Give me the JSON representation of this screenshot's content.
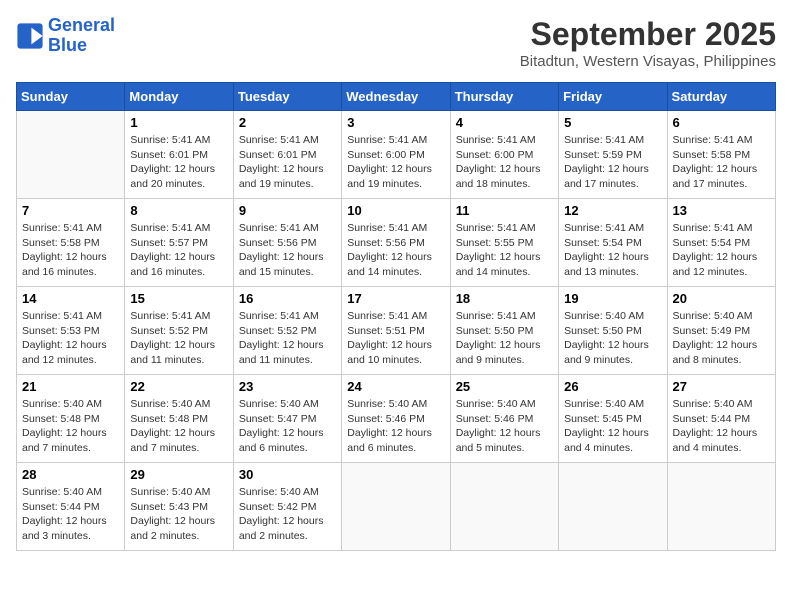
{
  "header": {
    "logo_line1": "General",
    "logo_line2": "Blue",
    "month": "September 2025",
    "location": "Bitadtun, Western Visayas, Philippines"
  },
  "weekdays": [
    "Sunday",
    "Monday",
    "Tuesday",
    "Wednesday",
    "Thursday",
    "Friday",
    "Saturday"
  ],
  "weeks": [
    [
      {
        "day": "",
        "info": ""
      },
      {
        "day": "1",
        "info": "Sunrise: 5:41 AM\nSunset: 6:01 PM\nDaylight: 12 hours\nand 20 minutes."
      },
      {
        "day": "2",
        "info": "Sunrise: 5:41 AM\nSunset: 6:01 PM\nDaylight: 12 hours\nand 19 minutes."
      },
      {
        "day": "3",
        "info": "Sunrise: 5:41 AM\nSunset: 6:00 PM\nDaylight: 12 hours\nand 19 minutes."
      },
      {
        "day": "4",
        "info": "Sunrise: 5:41 AM\nSunset: 6:00 PM\nDaylight: 12 hours\nand 18 minutes."
      },
      {
        "day": "5",
        "info": "Sunrise: 5:41 AM\nSunset: 5:59 PM\nDaylight: 12 hours\nand 17 minutes."
      },
      {
        "day": "6",
        "info": "Sunrise: 5:41 AM\nSunset: 5:58 PM\nDaylight: 12 hours\nand 17 minutes."
      }
    ],
    [
      {
        "day": "7",
        "info": "Sunrise: 5:41 AM\nSunset: 5:58 PM\nDaylight: 12 hours\nand 16 minutes."
      },
      {
        "day": "8",
        "info": "Sunrise: 5:41 AM\nSunset: 5:57 PM\nDaylight: 12 hours\nand 16 minutes."
      },
      {
        "day": "9",
        "info": "Sunrise: 5:41 AM\nSunset: 5:56 PM\nDaylight: 12 hours\nand 15 minutes."
      },
      {
        "day": "10",
        "info": "Sunrise: 5:41 AM\nSunset: 5:56 PM\nDaylight: 12 hours\nand 14 minutes."
      },
      {
        "day": "11",
        "info": "Sunrise: 5:41 AM\nSunset: 5:55 PM\nDaylight: 12 hours\nand 14 minutes."
      },
      {
        "day": "12",
        "info": "Sunrise: 5:41 AM\nSunset: 5:54 PM\nDaylight: 12 hours\nand 13 minutes."
      },
      {
        "day": "13",
        "info": "Sunrise: 5:41 AM\nSunset: 5:54 PM\nDaylight: 12 hours\nand 12 minutes."
      }
    ],
    [
      {
        "day": "14",
        "info": "Sunrise: 5:41 AM\nSunset: 5:53 PM\nDaylight: 12 hours\nand 12 minutes."
      },
      {
        "day": "15",
        "info": "Sunrise: 5:41 AM\nSunset: 5:52 PM\nDaylight: 12 hours\nand 11 minutes."
      },
      {
        "day": "16",
        "info": "Sunrise: 5:41 AM\nSunset: 5:52 PM\nDaylight: 12 hours\nand 11 minutes."
      },
      {
        "day": "17",
        "info": "Sunrise: 5:41 AM\nSunset: 5:51 PM\nDaylight: 12 hours\nand 10 minutes."
      },
      {
        "day": "18",
        "info": "Sunrise: 5:41 AM\nSunset: 5:50 PM\nDaylight: 12 hours\nand 9 minutes."
      },
      {
        "day": "19",
        "info": "Sunrise: 5:40 AM\nSunset: 5:50 PM\nDaylight: 12 hours\nand 9 minutes."
      },
      {
        "day": "20",
        "info": "Sunrise: 5:40 AM\nSunset: 5:49 PM\nDaylight: 12 hours\nand 8 minutes."
      }
    ],
    [
      {
        "day": "21",
        "info": "Sunrise: 5:40 AM\nSunset: 5:48 PM\nDaylight: 12 hours\nand 7 minutes."
      },
      {
        "day": "22",
        "info": "Sunrise: 5:40 AM\nSunset: 5:48 PM\nDaylight: 12 hours\nand 7 minutes."
      },
      {
        "day": "23",
        "info": "Sunrise: 5:40 AM\nSunset: 5:47 PM\nDaylight: 12 hours\nand 6 minutes."
      },
      {
        "day": "24",
        "info": "Sunrise: 5:40 AM\nSunset: 5:46 PM\nDaylight: 12 hours\nand 6 minutes."
      },
      {
        "day": "25",
        "info": "Sunrise: 5:40 AM\nSunset: 5:46 PM\nDaylight: 12 hours\nand 5 minutes."
      },
      {
        "day": "26",
        "info": "Sunrise: 5:40 AM\nSunset: 5:45 PM\nDaylight: 12 hours\nand 4 minutes."
      },
      {
        "day": "27",
        "info": "Sunrise: 5:40 AM\nSunset: 5:44 PM\nDaylight: 12 hours\nand 4 minutes."
      }
    ],
    [
      {
        "day": "28",
        "info": "Sunrise: 5:40 AM\nSunset: 5:44 PM\nDaylight: 12 hours\nand 3 minutes."
      },
      {
        "day": "29",
        "info": "Sunrise: 5:40 AM\nSunset: 5:43 PM\nDaylight: 12 hours\nand 2 minutes."
      },
      {
        "day": "30",
        "info": "Sunrise: 5:40 AM\nSunset: 5:42 PM\nDaylight: 12 hours\nand 2 minutes."
      },
      {
        "day": "",
        "info": ""
      },
      {
        "day": "",
        "info": ""
      },
      {
        "day": "",
        "info": ""
      },
      {
        "day": "",
        "info": ""
      }
    ]
  ]
}
